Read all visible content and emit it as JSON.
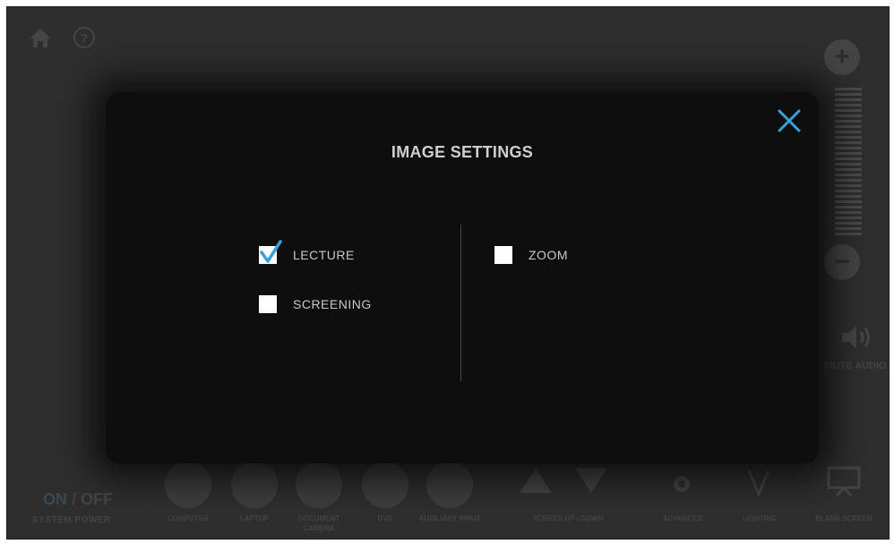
{
  "modal": {
    "title": "IMAGE SETTINGS",
    "options": [
      {
        "label": "LECTURE",
        "checked": true
      },
      {
        "label": "SCREENING",
        "checked": false
      },
      {
        "label": "ZOOM",
        "checked": false
      }
    ]
  },
  "background": {
    "power": {
      "on": "ON",
      "sep": "/",
      "off": "OFF",
      "label": "SYSTEM POWER"
    },
    "sources": [
      "COMPUTER",
      "LAPTOP",
      "DOCUMENT CAMERA",
      "DVD",
      "AUXILIARY INPUT"
    ],
    "screen_label": "SCREEN UP / DOWN",
    "advanced_label": "ADVANCED",
    "lighting_label": "LIGHTING",
    "blank_label": "BLANK SCREEN",
    "mute_label": "MUTE AUDIO"
  },
  "colors": {
    "accent": "#3aa0d8",
    "modal_bg": "#0e0e0e",
    "screen_bg": "#2e2e2e"
  },
  "icons": {
    "close": "close-icon",
    "check": "checkmark-icon",
    "home": "home-icon",
    "help": "help-icon"
  }
}
